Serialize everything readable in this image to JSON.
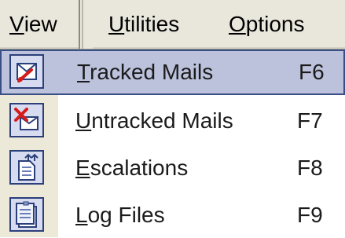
{
  "menubar": {
    "view": {
      "mnemonic": "V",
      "rest": "iew"
    },
    "utilities": {
      "mnemonic": "U",
      "rest": "tilities"
    },
    "options": {
      "mnemonic": "O",
      "rest": "ptions"
    }
  },
  "menu": {
    "items": [
      {
        "mnemonic": "T",
        "rest": "racked Mails",
        "shortcut": "F6",
        "icon": "tracked-mails-icon",
        "selected": true
      },
      {
        "mnemonic": "U",
        "rest": "ntracked Mails",
        "shortcut": "F7",
        "icon": "untracked-mails-icon",
        "selected": false
      },
      {
        "mnemonic": "E",
        "rest": "scalations",
        "shortcut": "F8",
        "icon": "escalations-icon",
        "selected": false
      },
      {
        "mnemonic": "L",
        "rest": "og Files",
        "shortcut": "F9",
        "icon": "log-files-icon",
        "selected": false
      }
    ]
  },
  "colors": {
    "menubar_bg": "#e9e7dc",
    "selection_bg": "#bcc2dc",
    "selection_border": "#3a4f86",
    "icon_border": "#2b3f7a"
  }
}
